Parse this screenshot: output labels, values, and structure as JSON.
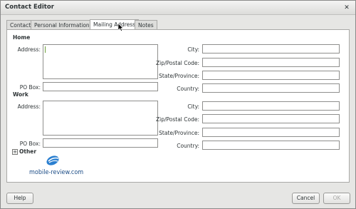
{
  "window": {
    "title": "Contact Editor"
  },
  "tabs": [
    {
      "label": "Contact",
      "active": false
    },
    {
      "label": "Personal Information",
      "active": false
    },
    {
      "label": "Mailing Address",
      "active": true
    },
    {
      "label": "Notes",
      "active": false
    }
  ],
  "home": {
    "heading": "Home",
    "address_label": "Address:",
    "address_value": "",
    "po_box_label": "PO Box:",
    "po_box_value": "",
    "city_label": "City:",
    "city_value": "",
    "zip_label": "Zip/Postal Code:",
    "zip_value": "",
    "state_label": "State/Province:",
    "state_value": "",
    "country_label": "Country:",
    "country_value": ""
  },
  "work": {
    "heading": "Work",
    "address_label": "Address:",
    "address_value": "",
    "po_box_label": "PO Box:",
    "po_box_value": "",
    "city_label": "City:",
    "city_value": "",
    "zip_label": "Zip/Postal Code:",
    "zip_value": "",
    "state_label": "State/Province:",
    "state_value": "",
    "country_label": "Country:",
    "country_value": ""
  },
  "other": {
    "label": "Other",
    "expander_symbol": "+"
  },
  "buttons": {
    "help": "Help",
    "cancel": "Cancel",
    "ok": "OK"
  },
  "watermark": {
    "text": "mobile-review.com"
  },
  "icons": {
    "close": "close-icon",
    "expander": "plus-icon",
    "cursor": "mouse-pointer-icon"
  },
  "colors": {
    "accent_watermark": "#1b4c86",
    "caret": "#6b9e3a"
  }
}
